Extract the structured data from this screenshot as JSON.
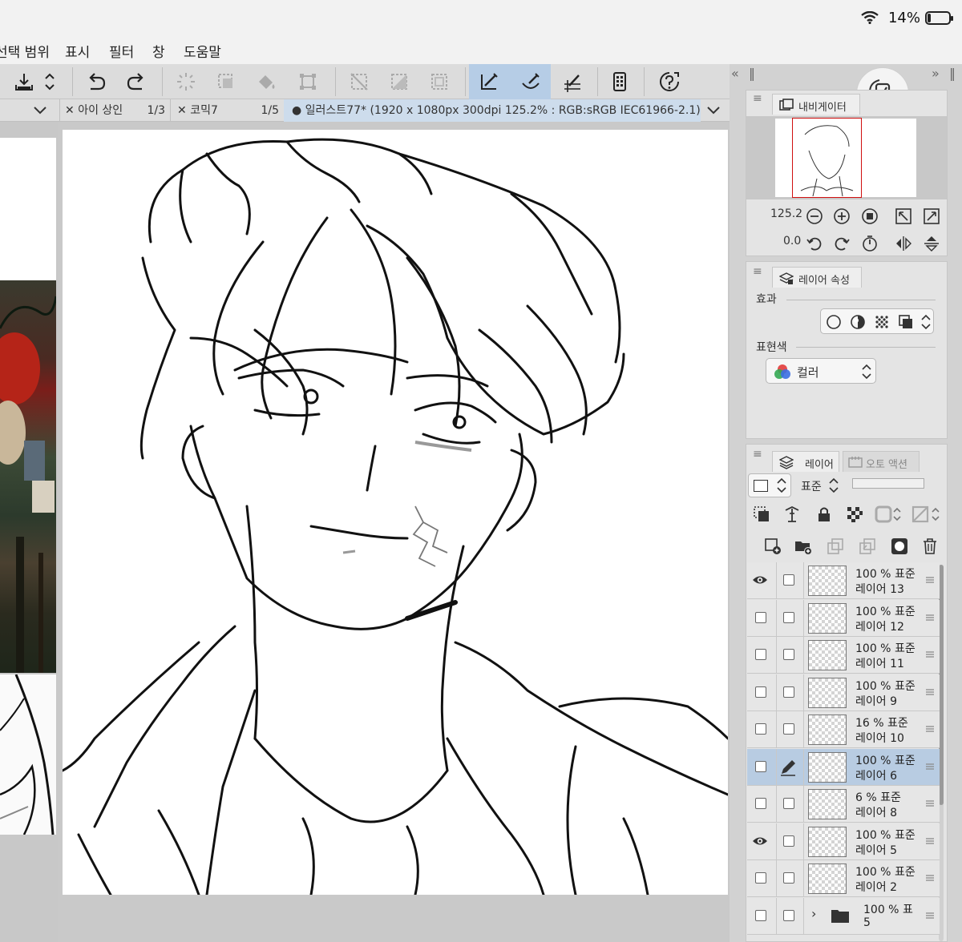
{
  "status_bar": {
    "battery_pct": "14%",
    "battery_level": 0.14
  },
  "menubar": {
    "items": [
      "선택 범위",
      "표시",
      "필터",
      "창",
      "도움말"
    ]
  },
  "tabs": [
    {
      "label": "아이 상인",
      "page": "1/3"
    },
    {
      "label": "코믹7",
      "page": "1/5"
    },
    {
      "label": "일러스트77* (1920 x 1080px 300dpi 125.2% : RGB:sRGB IEC61966-2.1)",
      "active": true
    }
  ],
  "navigator": {
    "tab_label": "내비게이터",
    "zoom": "125.2",
    "rotation": "0.0"
  },
  "layer_property": {
    "tab_label": "레이어 속성",
    "effect_label": "효과",
    "expression_label": "표현색",
    "color_mode": "컬러"
  },
  "layer_panel": {
    "tab_label": "레이어",
    "auto_action_label": "오토 액션",
    "blend_mode": "표준",
    "layers": [
      {
        "opacity": "100 %",
        "mode": "표준",
        "name": "레이어 13",
        "visible": true
      },
      {
        "opacity": "100 %",
        "mode": "표준",
        "name": "레이어 12",
        "visible": false
      },
      {
        "opacity": "100 %",
        "mode": "표준",
        "name": "레이어 11",
        "visible": false
      },
      {
        "opacity": "100 %",
        "mode": "표준",
        "name": "레이어 9",
        "visible": false
      },
      {
        "opacity": "16 %",
        "mode": "표준",
        "name": "레이어 10",
        "visible": false
      },
      {
        "opacity": "100 %",
        "mode": "표준",
        "name": "레이어 6",
        "visible": false,
        "selected": true
      },
      {
        "opacity": "6 %",
        "mode": "표준",
        "name": "레이어 8",
        "visible": false
      },
      {
        "opacity": "100 %",
        "mode": "표준",
        "name": "레이어 5",
        "visible": true
      },
      {
        "opacity": "100 %",
        "mode": "표준",
        "name": "레이어 2",
        "visible": false
      },
      {
        "opacity": "100 %",
        "mode": "표",
        "name": "5",
        "visible": false,
        "folder": true
      }
    ]
  },
  "colors": {
    "accent": "#b6cde6",
    "selected_row": "#b8cce2",
    "panel_bg": "#e4e4e4"
  }
}
